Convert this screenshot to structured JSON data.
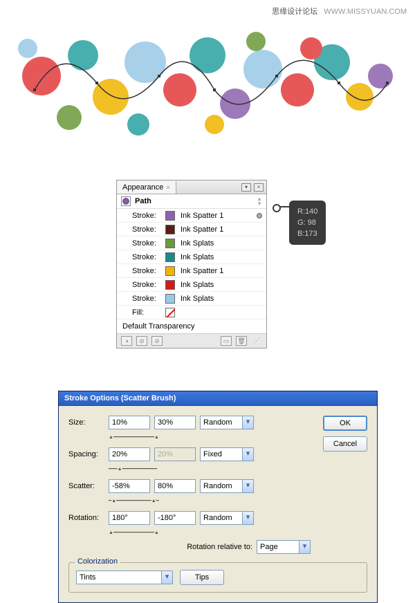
{
  "watermark": {
    "cn": "思缘设计论坛",
    "url": "WWW.MISSYUAN.COM"
  },
  "appearance": {
    "tab_label": "Appearance",
    "path_label": "Path",
    "strokes": [
      {
        "label": "Stroke:",
        "color": "#8c62ad",
        "name": "Ink Spatter 1",
        "linked": true
      },
      {
        "label": "Stroke:",
        "color": "#5a1e14",
        "name": "Ink Spatter 1",
        "linked": false
      },
      {
        "label": "Stroke:",
        "color": "#6b9a3a",
        "name": "Ink Splats",
        "linked": false
      },
      {
        "label": "Stroke:",
        "color": "#1a8a8a",
        "name": "Ink Splats",
        "linked": false
      },
      {
        "label": "Stroke:",
        "color": "#f0b400",
        "name": "Ink Spatter 1",
        "linked": false
      },
      {
        "label": "Stroke:",
        "color": "#d11a1a",
        "name": "Ink Splats",
        "linked": false
      },
      {
        "label": "Stroke:",
        "color": "#9ac9e6",
        "name": "Ink Splats",
        "linked": false
      }
    ],
    "fill_label": "Fill:",
    "default_trans": "Default Transparency"
  },
  "rgb": {
    "r_label": "R:",
    "r": "140",
    "g_label": "G:",
    "g": " 98",
    "b_label": "B:",
    "b": "173"
  },
  "stroke_options": {
    "title": "Stroke Options (Scatter Brush)",
    "size_label": "Size:",
    "size_a": "10%",
    "size_b": "30%",
    "size_mode": "Random",
    "spacing_label": "Spacing:",
    "spacing_a": "20%",
    "spacing_b": "20%",
    "spacing_mode": "Fixed",
    "scatter_label": "Scatter:",
    "scatter_a": "-58%",
    "scatter_b": "80%",
    "scatter_mode": "Random",
    "rotation_label": "Rotation:",
    "rotation_a": "180°",
    "rotation_b": "-180°",
    "rotation_mode": "Random",
    "rot_rel_label": "Rotation relative to:",
    "rot_rel_value": "Page",
    "colorization_legend": "Colorization",
    "color_method": "Tints",
    "tips_label": "Tips",
    "ok_label": "OK",
    "cancel_label": "Cancel"
  }
}
